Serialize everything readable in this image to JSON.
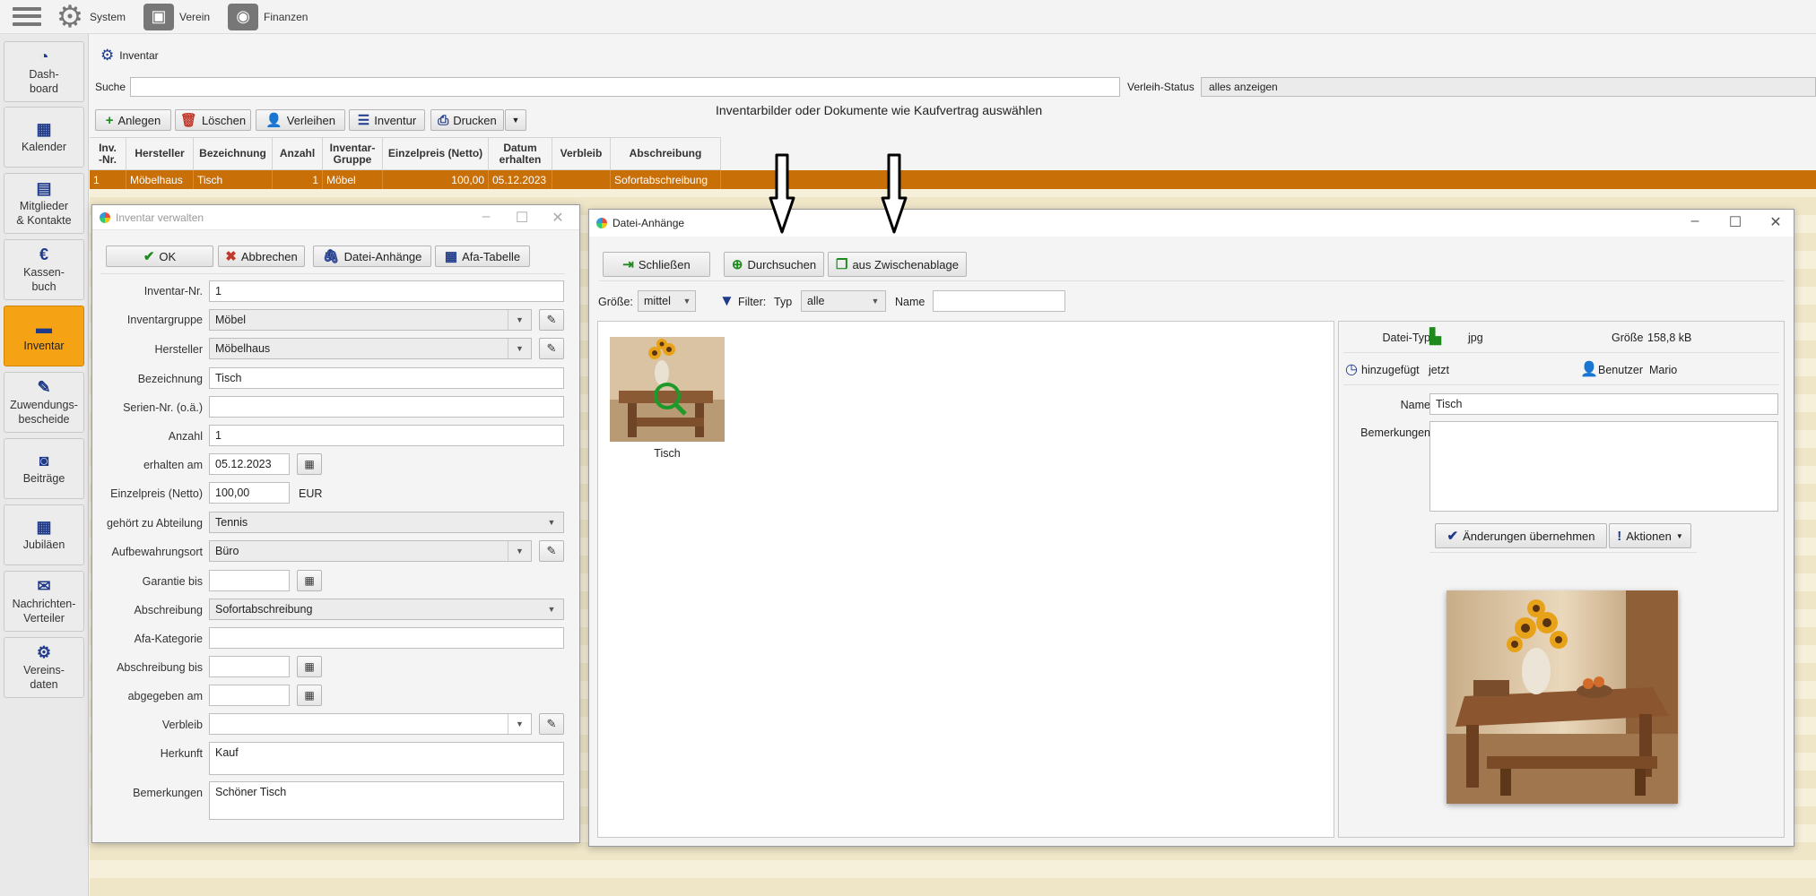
{
  "topbar": {
    "system_label": "System",
    "verein_label": "Verein",
    "finanzen_label": "Finanzen"
  },
  "sidebar": {
    "items": [
      {
        "label": "Dash-\nboard",
        "icon": "gauge-icon"
      },
      {
        "label": "Kalender",
        "icon": "calendar-icon"
      },
      {
        "label": "Mitglieder\n& Kontakte",
        "icon": "contacts-icon"
      },
      {
        "label": "Kassen-\nbuch",
        "icon": "euro-icon"
      },
      {
        "label": "Inventar",
        "icon": "box-icon"
      },
      {
        "label": "Zuwendungs-\nbescheide",
        "icon": "certificate-icon"
      },
      {
        "label": "Beiträge",
        "icon": "money-icon"
      },
      {
        "label": "Jubiläen",
        "icon": "calendar-icon"
      },
      {
        "label": "Nachrichten-\nVerteiler",
        "icon": "envelope-icon"
      },
      {
        "label": "Vereins-\ndaten",
        "icon": "gear-icon"
      }
    ],
    "active_color": "#f5a214"
  },
  "main": {
    "tab_title": "Inventar",
    "search_label": "Suche",
    "search_value": "",
    "status_label": "Verleih-Status",
    "status_value": "alles anzeigen",
    "toolbar": {
      "create": "Anlegen",
      "delete": "Löschen",
      "lend": "Verleihen",
      "inventory": "Inventur",
      "print": "Drucken"
    },
    "hint": "Inventarbilder oder Dokumente wie Kaufvertrag auswählen",
    "table": {
      "headers": [
        "Inv.\n-Nr.",
        "Hersteller",
        "Bezeichnung",
        "Anzahl",
        "Inventar-\nGruppe",
        "Einzelpreis (Netto)",
        "Datum\nerhalten",
        "Verbleib",
        "Abschreibung"
      ],
      "rows": [
        [
          "1",
          "Möbelhaus",
          "Tisch",
          "1",
          "Möbel",
          "100,00",
          "05.12.2023",
          "",
          "Sofortabschreibung"
        ]
      ],
      "selected_color": "#c96f08"
    }
  },
  "inventory_dialog": {
    "title": "Inventar verwalten",
    "buttons": {
      "ok": "OK",
      "cancel": "Abbrechen",
      "attachments": "Datei-Anhänge",
      "afa": "Afa-Tabelle"
    },
    "fields": {
      "inv_nr": {
        "label": "Inventar-Nr.",
        "value": "1"
      },
      "group": {
        "label": "Inventargruppe",
        "value": "Möbel"
      },
      "maker": {
        "label": "Hersteller",
        "value": "Möbelhaus"
      },
      "name": {
        "label": "Bezeichnung",
        "value": "Tisch"
      },
      "serial": {
        "label": "Serien-Nr. (o.ä.)",
        "value": ""
      },
      "count": {
        "label": "Anzahl",
        "value": "1"
      },
      "received": {
        "label": "erhalten am",
        "value": "05.12.2023"
      },
      "price": {
        "label": "Einzelpreis (Netto)",
        "value": "100,00",
        "unit": "EUR"
      },
      "department": {
        "label": "gehört zu Abteilung",
        "value": "Tennis"
      },
      "storage": {
        "label": "Aufbewahrungsort",
        "value": "Büro"
      },
      "warranty": {
        "label": "Garantie bis",
        "value": ""
      },
      "depreciation": {
        "label": "Abschreibung",
        "value": "Sofortabschreibung"
      },
      "afa_category": {
        "label": "Afa-Kategorie",
        "value": ""
      },
      "depreciation_until": {
        "label": "Abschreibung bis",
        "value": ""
      },
      "handed_over": {
        "label": "abgegeben am",
        "value": ""
      },
      "whereabouts": {
        "label": "Verbleib",
        "value": ""
      },
      "origin": {
        "label": "Herkunft",
        "value": "Kauf"
      },
      "remarks": {
        "label": "Bemerkungen",
        "value": "Schöner Tisch"
      }
    }
  },
  "attachments_dialog": {
    "title": "Datei-Anhänge",
    "buttons": {
      "close": "Schließen",
      "browse": "Durchsuchen",
      "clipboard": "aus Zwischenablage"
    },
    "filter": {
      "size_label": "Größe:",
      "size_value": "mittel",
      "filter_label": "Filter:",
      "type_label": "Typ",
      "type_value": "alle",
      "name_label": "Name",
      "name_value": ""
    },
    "thumbnail": {
      "caption": "Tisch"
    },
    "details": {
      "filetype_label": "Datei-Typ",
      "filetype_value": "jpg",
      "size_label": "Größe",
      "size_value": "158,8 kB",
      "added_label": "hinzugefügt",
      "added_value": "jetzt",
      "user_label": "Benutzer",
      "user_value": "Mario",
      "name_label": "Name",
      "name_value": "Tisch",
      "remarks_label": "Bemerkungen",
      "remarks_value": "",
      "apply_button": "Änderungen übernehmen",
      "actions_button": "Aktionen"
    }
  }
}
